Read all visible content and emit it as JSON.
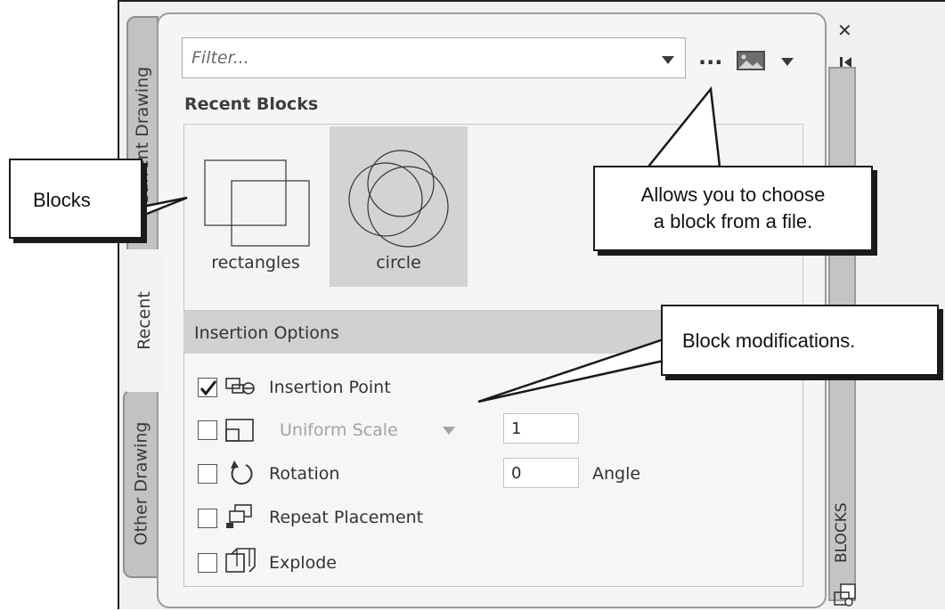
{
  "tabs": {
    "current_drawing": "Current Drawing",
    "recent": "Recent",
    "other_drawing": "Other Drawing"
  },
  "filter": {
    "placeholder": "Filter..."
  },
  "toolbar": {
    "browse_label": "..."
  },
  "recent_blocks": {
    "heading": "Recent Blocks",
    "items": [
      {
        "label": "rectangles",
        "icon": "rectangles-preview",
        "selected": false
      },
      {
        "label": "circle",
        "icon": "circles-preview",
        "selected": true
      }
    ]
  },
  "insertion_options": {
    "heading": "Insertion Options",
    "insertion_point": {
      "label": "Insertion Point",
      "checked": true,
      "icon": "insertion-point-icon"
    },
    "uniform_scale": {
      "label": "Uniform Scale",
      "checked": false,
      "value": "1",
      "icon": "scale-icon"
    },
    "rotation": {
      "label": "Rotation",
      "checked": false,
      "value": "0",
      "unit": "Angle",
      "icon": "rotation-icon"
    },
    "repeat_placement": {
      "label": "Repeat Placement",
      "checked": false,
      "icon": "repeat-placement-icon"
    },
    "explode": {
      "label": "Explode",
      "checked": false,
      "icon": "explode-icon"
    }
  },
  "palette": {
    "title": "BLOCKS",
    "icons": [
      "close-icon",
      "autohide-icon",
      "settings-icon"
    ]
  },
  "callouts": {
    "blocks": "Blocks",
    "browse_line1": "Allows you to choose",
    "browse_line2": "a block from a file.",
    "modifications": "Block modifications."
  }
}
